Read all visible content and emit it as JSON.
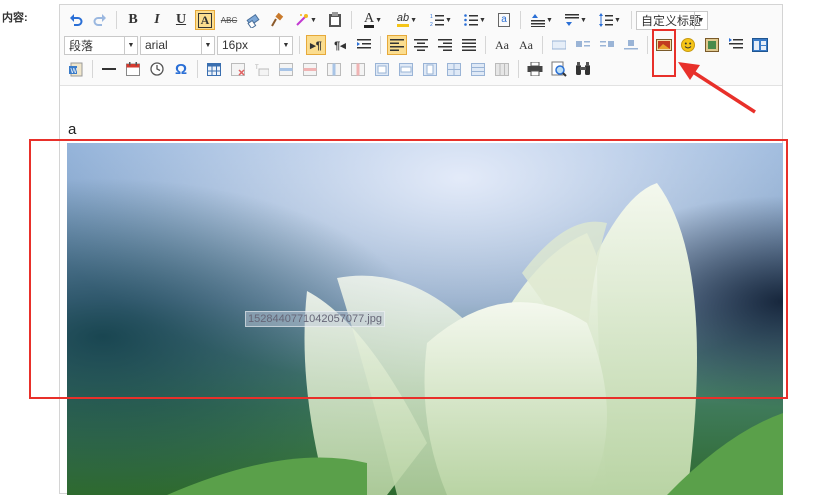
{
  "form": {
    "content_label": "内容:"
  },
  "toolbar": {
    "row1": [
      {
        "name": "undo-button",
        "glyph": "↶",
        "icon": "undo-icon"
      },
      {
        "name": "redo-button",
        "glyph": "↷",
        "icon": "redo-icon"
      },
      {
        "name": "bold-button",
        "glyph": "B",
        "icon": "bold-icon"
      },
      {
        "name": "italic-button",
        "glyph": "I",
        "icon": "italic-icon"
      },
      {
        "name": "underline-button",
        "glyph": "U",
        "icon": "underline-icon"
      },
      {
        "name": "font-border-button",
        "glyph": "A",
        "icon": "font-border-icon"
      },
      {
        "name": "strikethrough-button",
        "glyph": "ABC",
        "icon": "strikethrough-icon"
      },
      {
        "name": "eraser-button",
        "glyph": "⌫",
        "icon": "eraser-icon"
      },
      {
        "name": "format-painter-button",
        "glyph": "✎",
        "icon": "format-painter-icon"
      },
      {
        "name": "auto-typeset-button",
        "glyph": "✦",
        "icon": "magic-wand-icon"
      },
      {
        "name": "paste-plain-button",
        "glyph": "📋",
        "icon": "paste-icon"
      },
      {
        "name": "font-color-button",
        "glyph": "A",
        "icon": "font-color-icon"
      },
      {
        "name": "background-color-button",
        "glyph": "ab",
        "icon": "highlight-icon"
      },
      {
        "name": "ordered-list-button",
        "glyph": "≡",
        "icon": "ordered-list-icon"
      },
      {
        "name": "unordered-list-button",
        "glyph": "≡",
        "icon": "unordered-list-icon"
      },
      {
        "name": "select-all-button",
        "glyph": "a",
        "icon": "select-all-icon"
      },
      {
        "name": "row-spacing-top-button",
        "glyph": "≡",
        "icon": "spacing-top-icon"
      },
      {
        "name": "row-spacing-bottom-button",
        "glyph": "≡",
        "icon": "spacing-bottom-icon"
      },
      {
        "name": "line-height-button",
        "glyph": "≡",
        "icon": "line-height-icon"
      }
    ],
    "custom_heading": "自定义标题",
    "paragraph": "段落",
    "font_family": "arial",
    "font_size": "16px"
  },
  "editor": {
    "text": "a",
    "image_filename": "1528440771042057077.jpg"
  },
  "colors": {
    "highlight": "#e8302a",
    "active": "#fbdd8f"
  }
}
